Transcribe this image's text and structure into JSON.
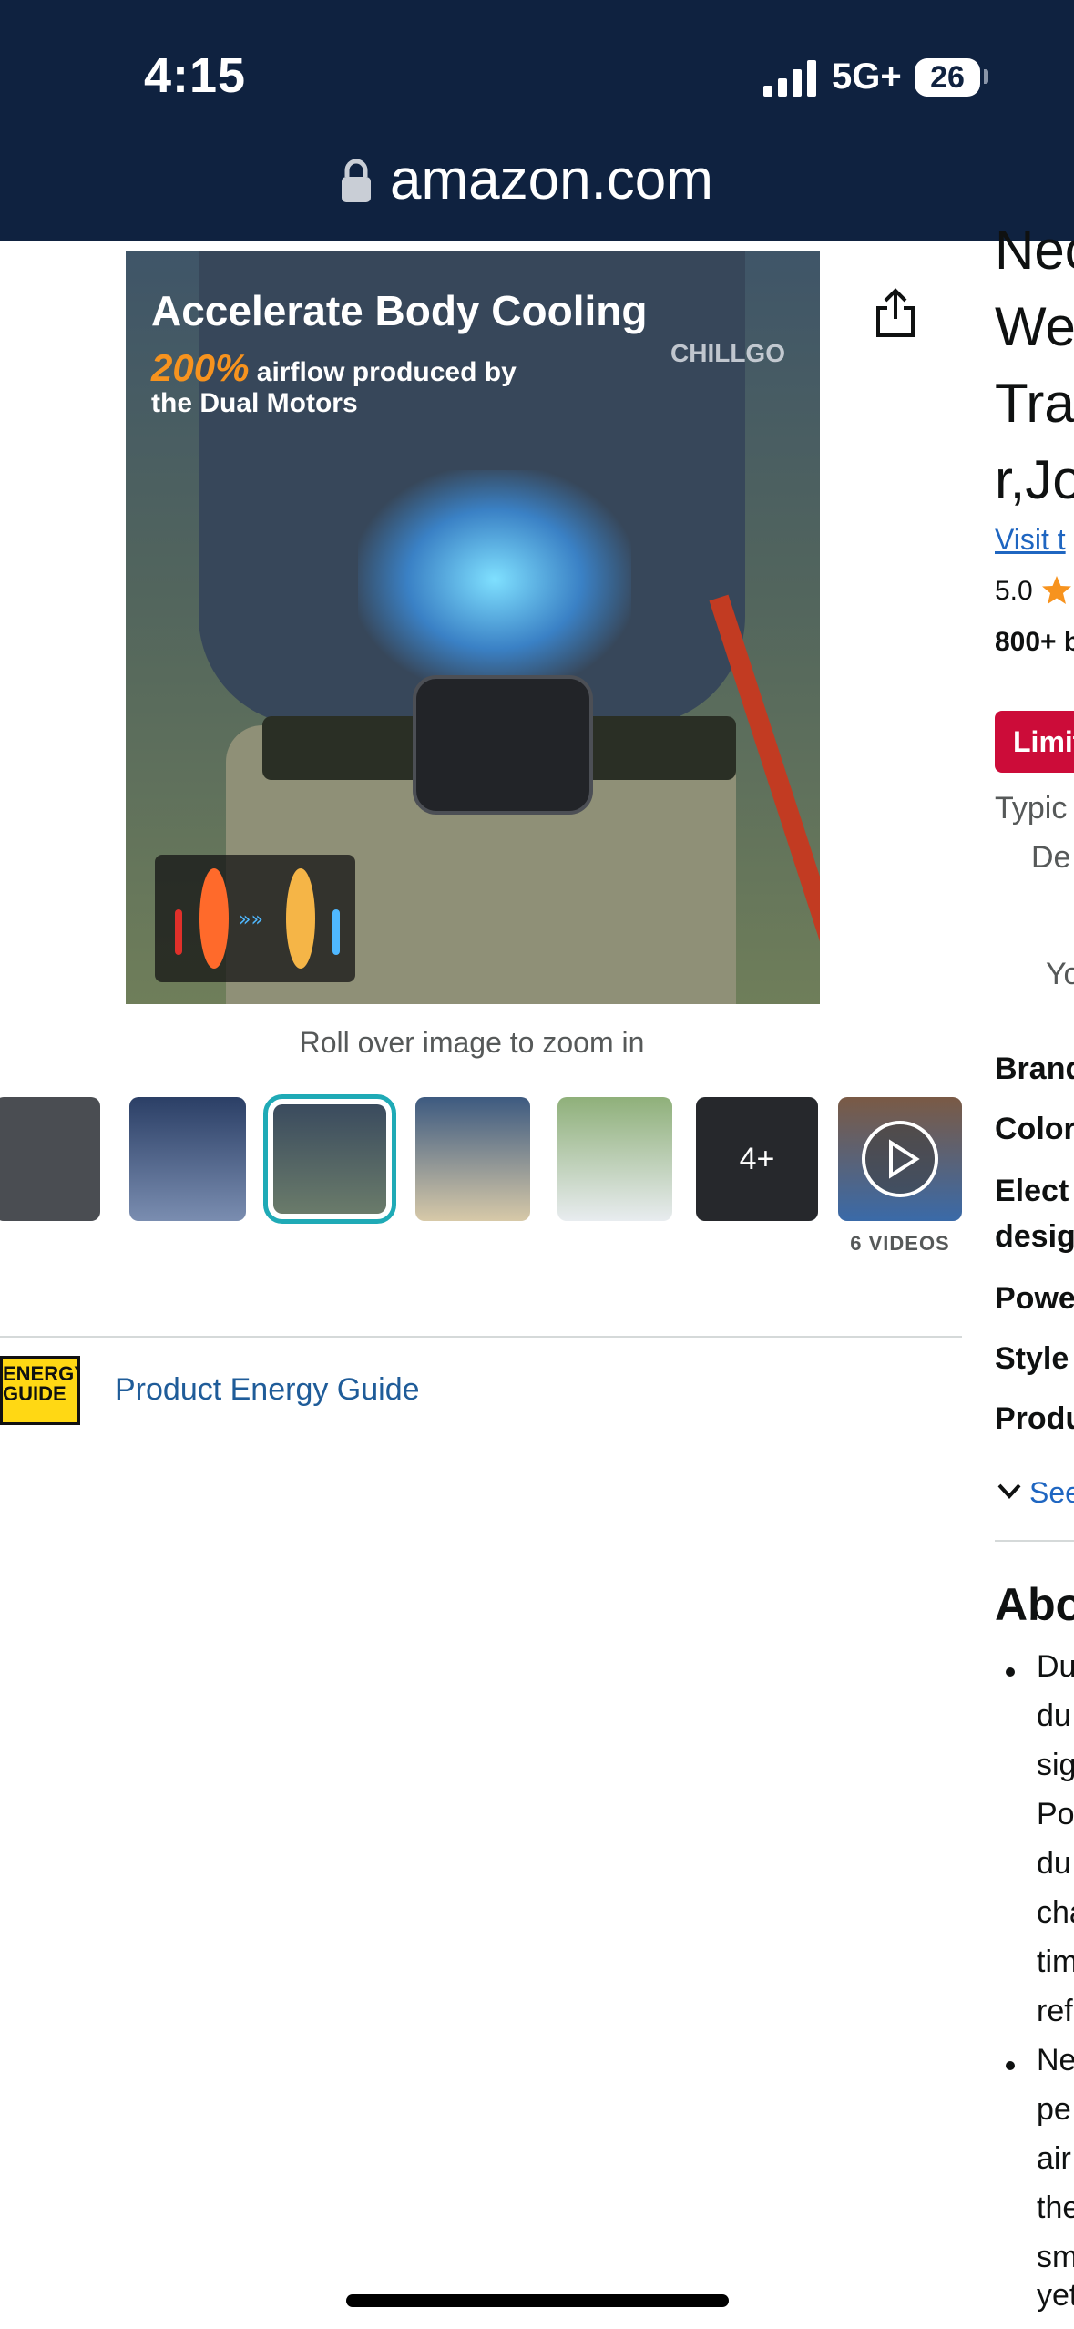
{
  "status_bar": {
    "time": "4:15",
    "network": "5G+",
    "battery": "26"
  },
  "browser": {
    "url": "amazon.com"
  },
  "hero": {
    "headline": "Accelerate Body Cooling",
    "highlight": "200%",
    "subline1_rest": " airflow produced by",
    "subline2": "the Dual Motors",
    "brand": "CHILLGO"
  },
  "gallery": {
    "zoom_hint": "Roll over image to zoom in",
    "more_count": "4+",
    "videos_label": "6 VIDEOS",
    "thumbnails": [
      "thumb-1",
      "thumb-2",
      "thumb-3",
      "thumb-4",
      "thumb-5",
      "thumb-6",
      "thumb-video"
    ]
  },
  "energy": {
    "badge_text": "ENERGY GUIDE",
    "link": "Product Energy Guide"
  },
  "right_column": {
    "title_lines": [
      "Nec",
      "We",
      "Tra",
      "r,Jo"
    ],
    "visit_link": "Visit t",
    "rating": "5.0",
    "bought": "800+ b",
    "deal_badge": "Limit",
    "typical": "Typic",
    "de": "De",
    "yo": "Yo",
    "specs": [
      "Brand",
      "Color",
      "Elect",
      "desig",
      "Powe",
      "Style",
      "Produ"
    ],
    "see_more": "See",
    "about": "Abo",
    "bullet1_lines": [
      "Du",
      "du",
      "sig",
      "Po",
      "du",
      "cha",
      "tim",
      "ref"
    ],
    "bullet2_lines": [
      "Ne",
      "pe",
      "air",
      "the",
      "sm",
      "yet"
    ]
  },
  "colors": {
    "top_bar": "#0f2240",
    "link": "#1f5c99",
    "deal": "#cc0c39",
    "accent_star": "#f7931e",
    "thumb_outline": "#1faab6"
  }
}
